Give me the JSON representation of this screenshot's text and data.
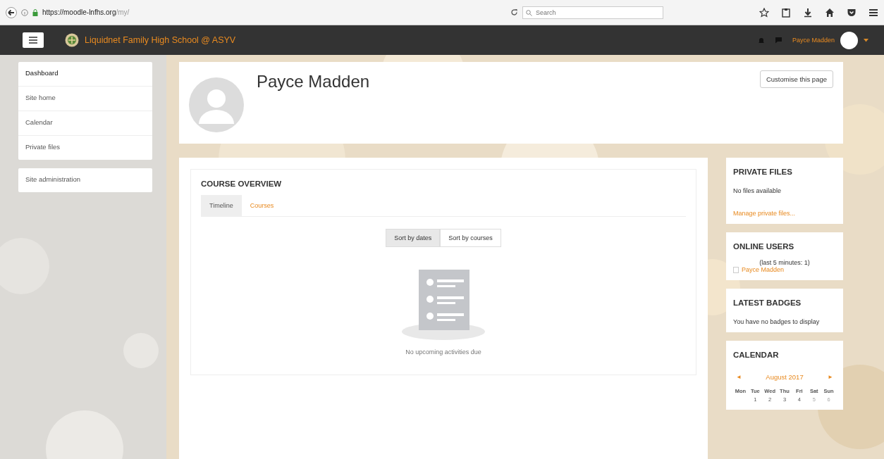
{
  "browser": {
    "url_host": "https://moodle-lnfhs.org",
    "url_path": "/my/",
    "search": {
      "placeholder": "Search"
    }
  },
  "navbar": {
    "site_name": "Liquidnet Family High School @ ASYV",
    "user_name": "Payce Madden"
  },
  "sidebar": {
    "items": [
      {
        "label": "Dashboard",
        "selected": true
      },
      {
        "label": "Site home",
        "selected": false
      },
      {
        "label": "Calendar",
        "selected": false
      },
      {
        "label": "Private files",
        "selected": false
      }
    ],
    "admin": "Site administration"
  },
  "header": {
    "name": "Payce Madden",
    "button": "Customise this page"
  },
  "course_overview": {
    "title": "COURSE OVERVIEW",
    "tabs": [
      {
        "label": "Timeline",
        "selected": true
      },
      {
        "label": "Courses",
        "selected": false
      }
    ],
    "sort": [
      {
        "label": "Sort by dates",
        "selected": true
      },
      {
        "label": "Sort by courses",
        "selected": false
      }
    ],
    "empty": "No upcoming activities due"
  },
  "blocks": {
    "private_files": {
      "title": "PRIVATE FILES",
      "text": "No files available",
      "link": "Manage private files..."
    },
    "online_users": {
      "title": "ONLINE USERS",
      "text": "(last 5 minutes: 1)",
      "user": "Payce Madden"
    },
    "badges": {
      "title": "LATEST BADGES",
      "text": "You have no badges to display"
    },
    "calendar": {
      "title": "CALENDAR",
      "prev": "◄",
      "month": "August 2017",
      "next": "►",
      "weekdays": [
        "Mon",
        "Tue",
        "Wed",
        "Thu",
        "Fri",
        "Sat",
        "Sun"
      ],
      "days": [
        "1",
        "2",
        "3",
        "4",
        "5",
        "6"
      ]
    }
  }
}
